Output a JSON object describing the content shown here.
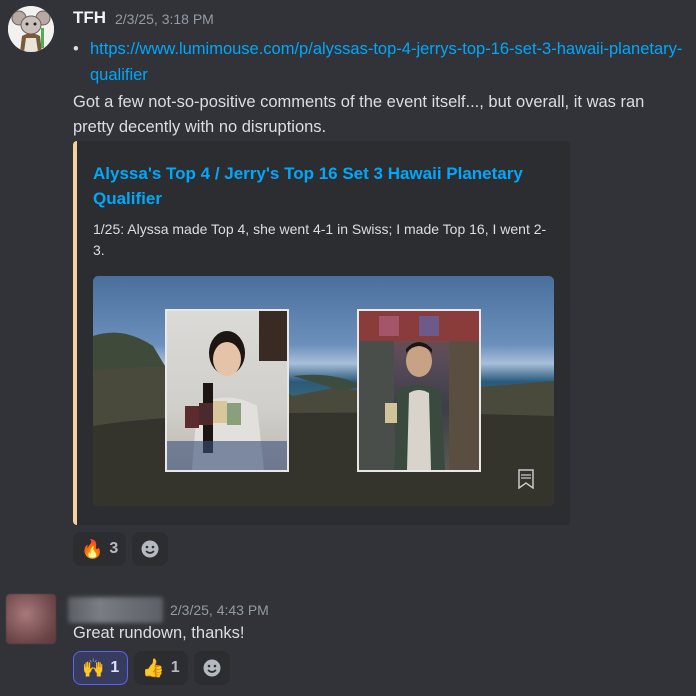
{
  "messages": [
    {
      "author": "TFH",
      "timestamp": "2/3/25, 3:18 PM",
      "link": "https://www.lumimouse.com/p/alyssas-top-4-jerrys-top-16-set-3-hawaii-planetary-qualifier",
      "text": "Got a few not-so-positive comments of the event itself..., but overall, it was ran pretty decently with no disruptions.",
      "embed": {
        "title": "Alyssa's Top 4 / Jerry's Top 16 Set 3 Hawaii Planetary Qualifier",
        "description": "1/25: Alyssa made Top 4, she went 4-1 in Swiss; I made Top 16, I went 2-3."
      },
      "reactions": [
        {
          "emoji": "🔥",
          "count": "3"
        }
      ]
    },
    {
      "author": "",
      "timestamp": "2/3/25, 4:43 PM",
      "text": "Great rundown, thanks!",
      "reactions": [
        {
          "emoji": "🙌",
          "count": "1"
        },
        {
          "emoji": "👍",
          "count": "1"
        }
      ]
    }
  ],
  "icons": {
    "add_reaction": "smiley-add-icon",
    "bullet": "•",
    "bookmark": "bookmark-icon"
  },
  "colors": {
    "background": "#313338",
    "embed_bg": "#2b2d31",
    "embed_accent": "#f2d3a0",
    "link": "#00a8fc",
    "active_reaction": "#5865f2"
  }
}
